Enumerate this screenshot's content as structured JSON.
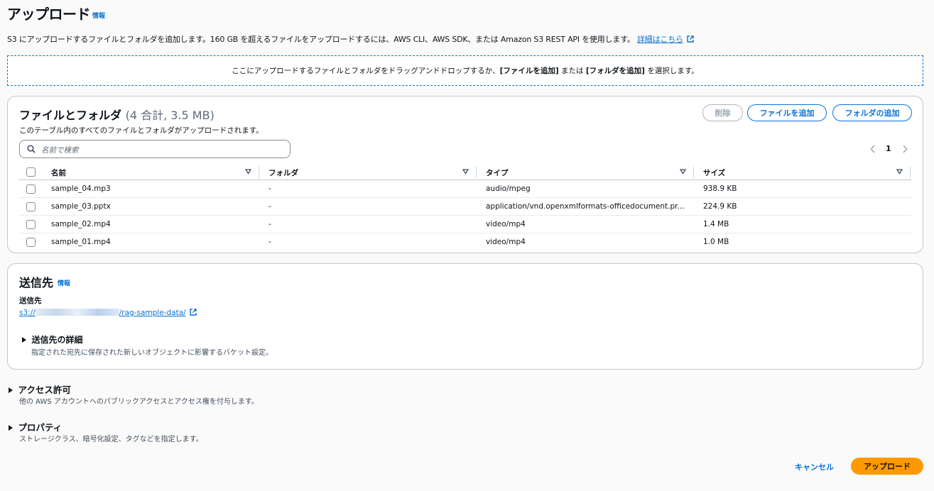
{
  "header": {
    "title": "アップロード",
    "info": "情報",
    "description": "S3 にアップロードするファイルとフォルダを追加します。160 GB を超えるファイルをアップロードするには、AWS CLI、AWS SDK、または Amazon S3 REST API を使用します。",
    "learn_more": "詳細はこちら"
  },
  "dropzone": {
    "text_before": "ここにアップロードするファイルとフォルダをドラッグアンドドロップするか、",
    "add_files": "[ファイルを追加]",
    "or": " または ",
    "add_folder": "[フォルダを追加]",
    "text_after": " を選択します。"
  },
  "files": {
    "title": "ファイルとフォルダ",
    "count": "(4 合計, 3.5 MB)",
    "subtitle": "このテーブル内のすべてのファイルとフォルダがアップロードされます。",
    "delete_label": "削除",
    "add_files_label": "ファイルを追加",
    "add_folder_label": "フォルダの追加",
    "search_placeholder": "名前で検索",
    "page": "1",
    "columns": [
      "名前",
      "フォルダ",
      "タイプ",
      "サイズ"
    ],
    "rows": [
      {
        "name": "sample_04.mp3",
        "folder": "-",
        "type": "audio/mpeg",
        "size": "938.9 KB"
      },
      {
        "name": "sample_03.pptx",
        "folder": "-",
        "type": "application/vnd.openxmlformats-officedocument.pr...",
        "size": "224.9 KB"
      },
      {
        "name": "sample_02.mp4",
        "folder": "-",
        "type": "video/mp4",
        "size": "1.4 MB"
      },
      {
        "name": "sample_01.mp4",
        "folder": "-",
        "type": "video/mp4",
        "size": "1.0 MB"
      }
    ]
  },
  "destination": {
    "title": "送信先",
    "info": "情報",
    "label": "送信先",
    "path_prefix": "s3://",
    "path_suffix": "/rag-sample-data/",
    "details_title": "送信先の詳細",
    "details_desc": "指定された宛先に保存された新しいオブジェクトに影響するバケット設定。"
  },
  "permissions": {
    "title": "アクセス許可",
    "desc": "他の AWS アカウントへのパブリックアクセスとアクセス権を付与します。"
  },
  "properties": {
    "title": "プロパティ",
    "desc": "ストレージクラス、暗号化設定、タグなどを指定します。"
  },
  "footer": {
    "cancel_label": "キャンセル",
    "upload_label": "アップロード"
  },
  "colors": {
    "accent": "#0972d3",
    "primary": "#ff9900"
  }
}
